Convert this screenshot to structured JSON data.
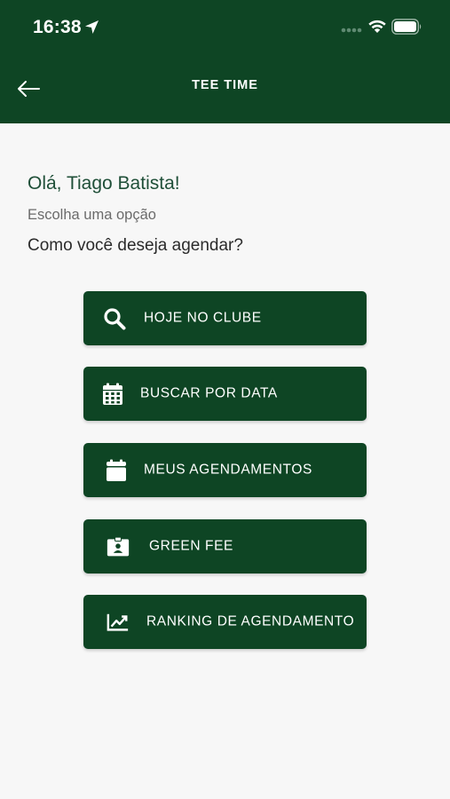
{
  "status_bar": {
    "time": "16:38"
  },
  "header": {
    "title": "TEE TIME",
    "back_icon": "arrow-left-icon",
    "background_color": "#0e4524"
  },
  "content": {
    "greeting": "Olá, Tiago Batista!",
    "subtitle": "Escolha uma opção",
    "question": "Como você deseja agendar?"
  },
  "menu": [
    {
      "label": "HOJE NO CLUBE",
      "icon": "search-icon"
    },
    {
      "label": "BUSCAR POR DATA",
      "icon": "calendar-grid-icon"
    },
    {
      "label": "MEUS AGENDAMENTOS",
      "icon": "calendar-icon"
    },
    {
      "label": "GREEN FEE",
      "icon": "id-badge-icon"
    },
    {
      "label": "RANKING DE AGENDAMENTO",
      "icon": "chart-line-icon"
    }
  ],
  "colors": {
    "brand_green": "#0e4524",
    "background": "#f7f7f7"
  }
}
